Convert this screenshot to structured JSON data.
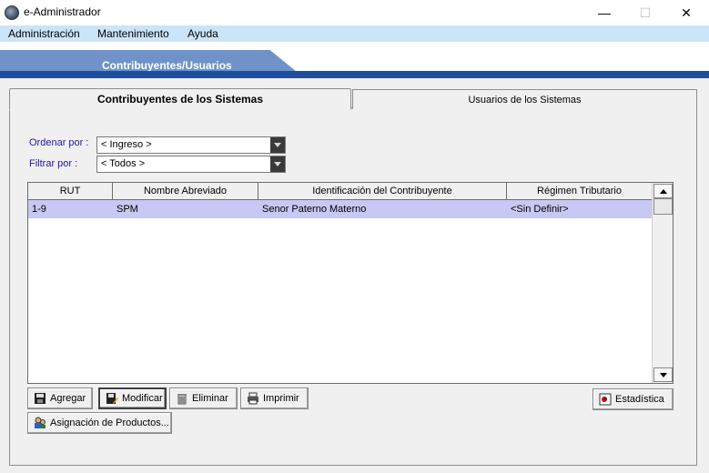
{
  "window": {
    "title": "e-Administrador",
    "controls": {
      "minimize": "—",
      "maximize": "☐",
      "close": "✕"
    }
  },
  "menu": [
    "Administración",
    "Mantenimiento",
    "Ayuda"
  ],
  "banner": {
    "section": "Contribuyentes/Usuarios"
  },
  "tabs": [
    {
      "label": "Contribuyentes de los Sistemas",
      "active": true
    },
    {
      "label": "Usuarios de los Sistemas",
      "active": false
    }
  ],
  "filters": {
    "order_label": "Ordenar por :",
    "order_value": "< Ingreso >",
    "filter_label": "Filtrar por :",
    "filter_value": "< Todos >"
  },
  "grid": {
    "columns": [
      "RUT",
      "Nombre Abreviado",
      "Identificación del Contribuyente",
      "Régimen Tributario"
    ],
    "rows": [
      [
        "1-9",
        "SPM",
        "Senor Paterno Materno",
        "<Sin Definir>"
      ]
    ]
  },
  "buttons": {
    "add": "Agregar",
    "modify": "Modificar",
    "delete": "Eliminar",
    "print": "Imprimir",
    "stats": "Estadística",
    "assign": "Asignación de Productos..."
  },
  "colors": {
    "menubar": "#cce4f7",
    "banner_tab": "#6f93c8",
    "banner_bar": "#1f4f9c",
    "selected_row": "#c8c8f4",
    "label_blue": "#1a1aa6"
  }
}
